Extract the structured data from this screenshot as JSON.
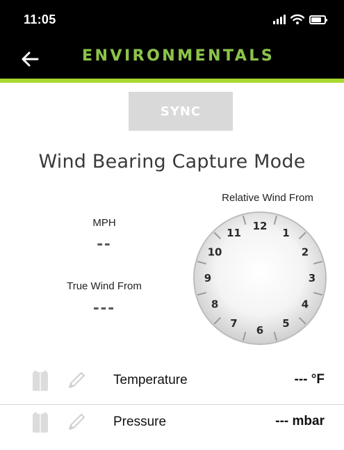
{
  "status_bar": {
    "time": "11:05",
    "icons": [
      "signal-icon",
      "wifi-icon",
      "battery-icon"
    ]
  },
  "header": {
    "back_icon": "arrow-left-icon",
    "title": "ENVIRONMENTALS",
    "title_color": "#8bc34a",
    "accent_color": "#a8d82e"
  },
  "sync": {
    "label": "SYNC",
    "background": "#d9d9d9"
  },
  "wind": {
    "mode_title": "Wind Bearing Capture Mode",
    "relative_label": "Relative Wind From",
    "speed_label": "MPH",
    "speed_value": "--",
    "true_label": "True Wind From",
    "true_value": "---",
    "dial_numbers": [
      "12",
      "1",
      "2",
      "3",
      "4",
      "5",
      "6",
      "7",
      "8",
      "9",
      "10",
      "11"
    ]
  },
  "readings": [
    {
      "name": "Temperature",
      "value": "--- °F",
      "book_icon": "book-icon",
      "edit_icon": "pencil-icon"
    },
    {
      "name": "Pressure",
      "value": "--- mbar",
      "book_icon": "book-icon",
      "edit_icon": "pencil-icon"
    }
  ]
}
